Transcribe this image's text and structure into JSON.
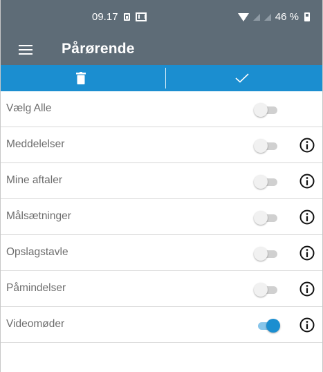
{
  "status_bar": {
    "time": "09.17",
    "battery": "46 %"
  },
  "app_bar": {
    "title": "Pårørende"
  },
  "colors": {
    "header": "#5e6c77",
    "accent": "#1b8ed0"
  },
  "actions": {
    "delete_icon": "trash-icon",
    "confirm_icon": "checkmark-icon"
  },
  "rows": [
    {
      "label": "Vælg Alle",
      "enabled": false,
      "has_info": false
    },
    {
      "label": "Meddelelser",
      "enabled": false,
      "has_info": true
    },
    {
      "label": "Mine aftaler",
      "enabled": false,
      "has_info": true
    },
    {
      "label": "Målsætninger",
      "enabled": false,
      "has_info": true
    },
    {
      "label": "Opslagstavle",
      "enabled": false,
      "has_info": true
    },
    {
      "label": "Påmindelser",
      "enabled": false,
      "has_info": true
    },
    {
      "label": "Videomøder",
      "enabled": true,
      "has_info": true
    }
  ]
}
